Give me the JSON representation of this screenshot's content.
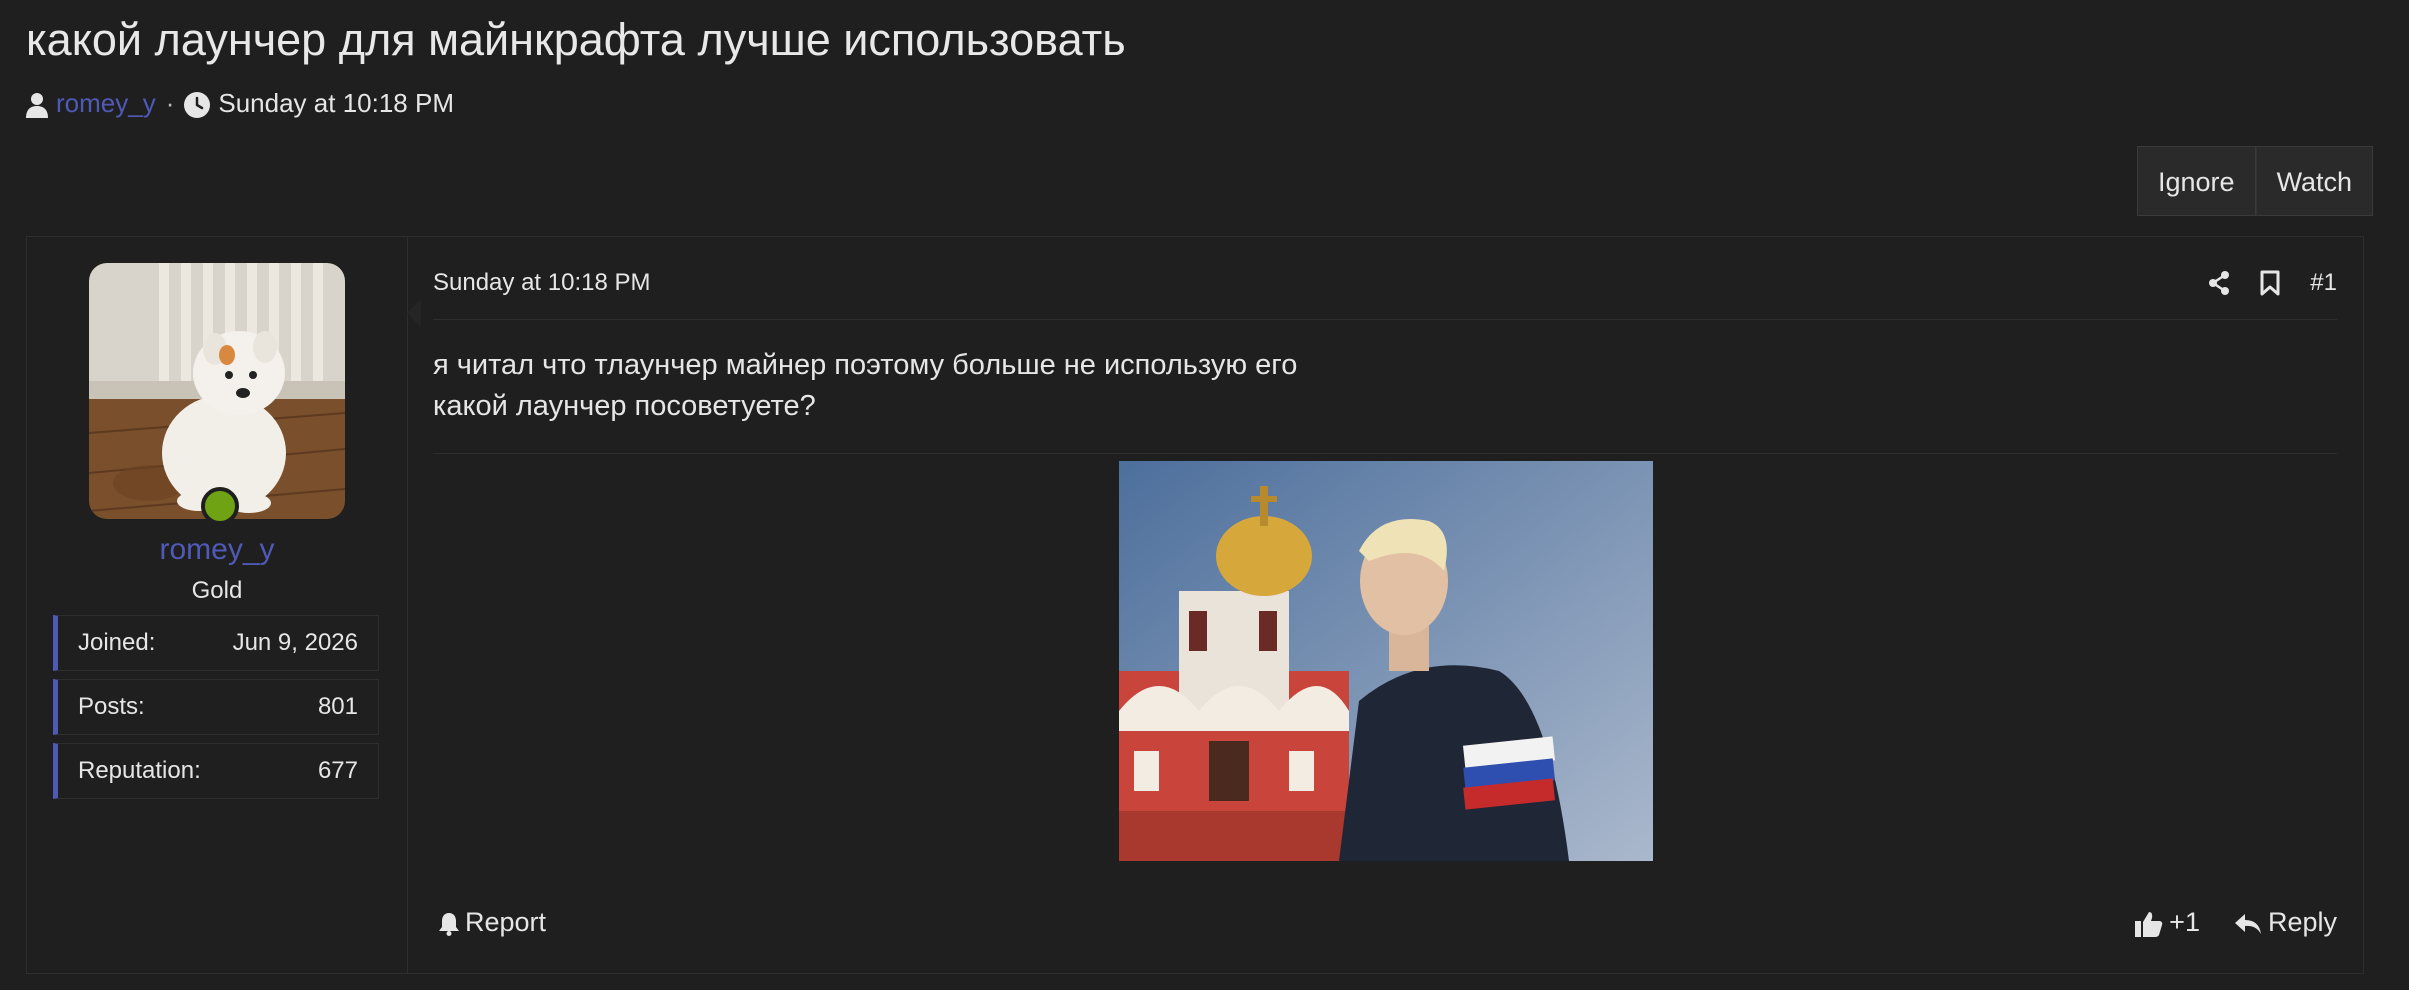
{
  "thread": {
    "title": "какой лаунчер для майнкрафта лучше использовать",
    "author": "romey_y",
    "separator": "·",
    "date": "Sunday at 10:18 PM"
  },
  "thread_actions": {
    "ignore_label": "Ignore",
    "watch_label": "Watch"
  },
  "user": {
    "name": "romey_y",
    "title": "Gold",
    "online": true,
    "stats": [
      {
        "label": "Joined:",
        "value": "Jun 9, 2026"
      },
      {
        "label": "Posts:",
        "value": "801"
      },
      {
        "label": "Reputation:",
        "value": "677"
      }
    ]
  },
  "post": {
    "date": "Sunday at 10:18 PM",
    "number": "#1",
    "body_lines": [
      "я читал что тлаунчер майнер поэтому больше не использую его",
      "какой лаунчер посоветуете?"
    ],
    "report_label": "Report",
    "reaction_label": "+1",
    "reply_label": "Reply"
  },
  "icons": {
    "author": "user-icon",
    "date": "clock-icon",
    "share": "share-icon",
    "bookmark": "bookmark-icon",
    "report": "bell-icon",
    "like": "thumbs-up-icon",
    "reply": "reply-icon"
  },
  "colors": {
    "accent": "#4f5ab7",
    "online": "#6fa313",
    "background": "#1f1f1f"
  }
}
